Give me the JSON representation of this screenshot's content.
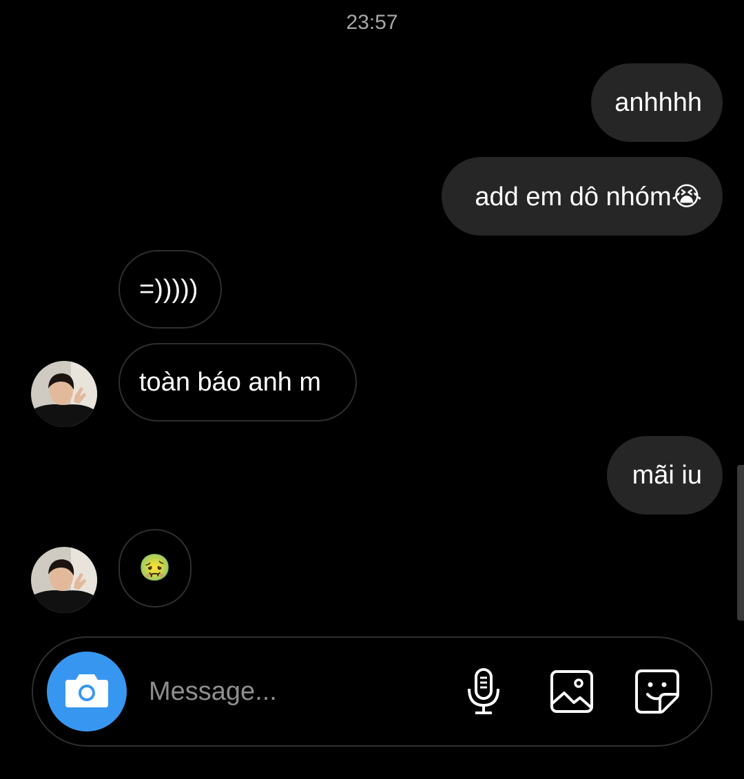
{
  "header": {
    "timestamp": "23:57"
  },
  "messages": [
    {
      "direction": "outgoing",
      "text": "anhhhh"
    },
    {
      "direction": "outgoing",
      "text": "add em dô nhóm😭"
    },
    {
      "direction": "incoming",
      "text": "=)))))"
    },
    {
      "direction": "incoming",
      "text": "toàn báo anh m"
    },
    {
      "direction": "outgoing",
      "text": "mãi iu"
    },
    {
      "direction": "incoming",
      "text": "🤢"
    }
  ],
  "composer": {
    "placeholder": "Message...",
    "icons": [
      "camera-icon",
      "microphone-icon",
      "gallery-icon",
      "sticker-icon"
    ]
  },
  "colors": {
    "background": "#000000",
    "outgoing_bubble": "#262626",
    "incoming_border": "#2f2f2f",
    "accent": "#3797f0",
    "timestamp": "#a8a8a8"
  }
}
